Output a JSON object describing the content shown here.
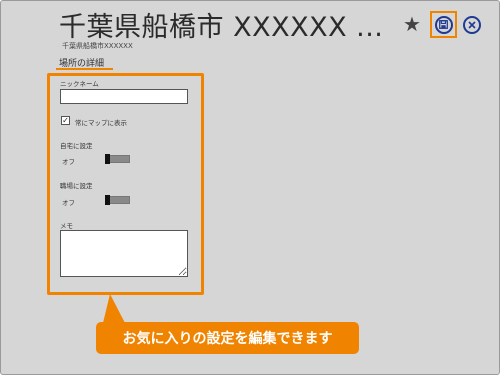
{
  "header": {
    "title": "千葉県船橋市 XXXXXX ...",
    "subtitle": "千葉県船橋市XXXXXX"
  },
  "section": {
    "title": "場所の詳細"
  },
  "form": {
    "nickname_label": "ニックネーム",
    "nickname_value": "",
    "always_show_label": "常にマップに表示",
    "always_show_checked": true,
    "home_label": "自宅に設定",
    "home_state_label": "オフ",
    "home_on": false,
    "work_label": "職場に設定",
    "work_state_label": "オフ",
    "work_on": false,
    "memo_label": "メモ",
    "memo_value": ""
  },
  "callout": {
    "text": "お気に入りの設定を編集できます"
  },
  "icons": {
    "favorite": "star-icon",
    "save": "save-icon",
    "close": "close-icon"
  },
  "colors": {
    "highlight": "#f08300",
    "accent": "#1f3a93",
    "background": "#d6d6d6"
  }
}
